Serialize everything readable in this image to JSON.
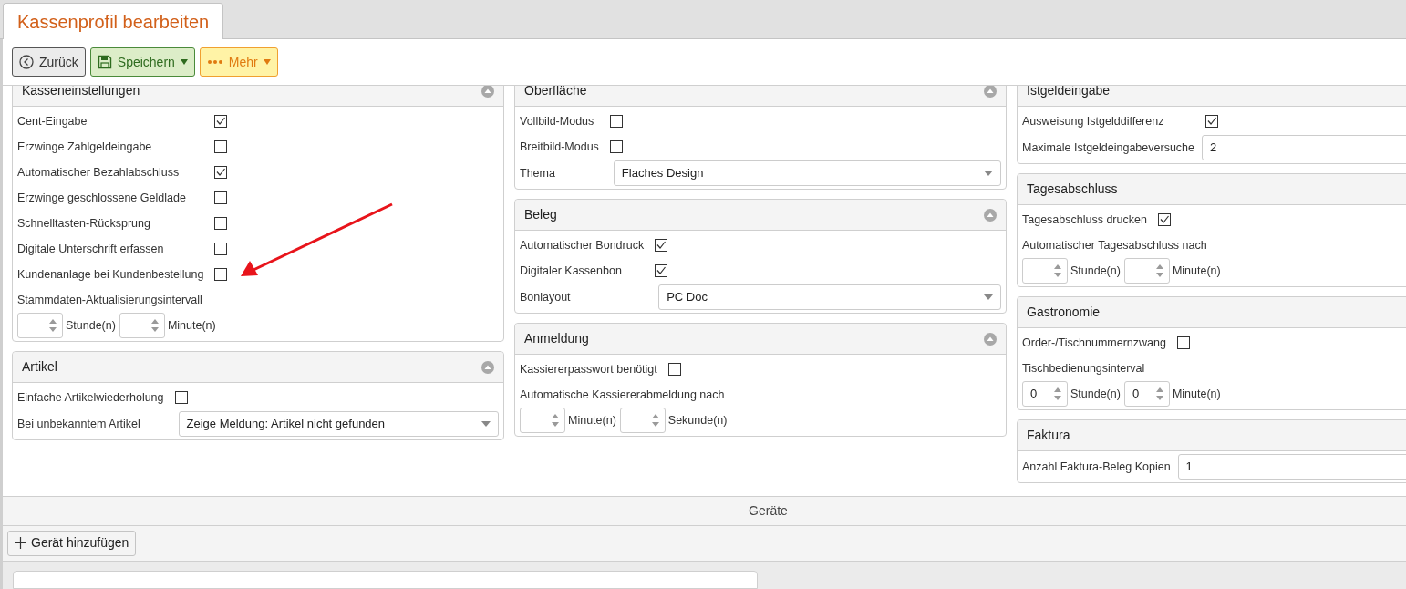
{
  "tab": {
    "label": "Kassenprofil bearbeiten",
    "selected": true
  },
  "toolbar": [
    {
      "kind": "back",
      "label": "Zurück"
    },
    {
      "kind": "save",
      "label": "Speichern"
    },
    {
      "kind": "more",
      "label": "Mehr"
    }
  ],
  "columns": [
    [
      {
        "title": "Kasseneinstellungen",
        "expanded": true,
        "rows": [
          {
            "kind": "checkbox",
            "label": "Cent-Eingabe",
            "checked": true
          },
          {
            "kind": "checkbox",
            "label": "Erzwinge Zahlgeldeingabe",
            "checked": false
          },
          {
            "kind": "checkbox",
            "label": "Automatischer Bezahlabschluss",
            "checked": true
          },
          {
            "kind": "checkbox",
            "label": "Erzwinge geschlossene Geldlade",
            "checked": false
          },
          {
            "kind": "checkbox",
            "label": "Schnelltasten-Rücksprung",
            "checked": false
          },
          {
            "kind": "checkbox",
            "label": "Digitale Unterschrift erfassen",
            "checked": false
          },
          {
            "kind": "checkbox",
            "label": "Kundenanlage bei Kundenbestellung",
            "checked": false
          },
          {
            "kind": "interval",
            "label": "Stammdaten-Aktualisierungsintervall",
            "units": [
              {
                "unit": "Stunde(n)"
              },
              {
                "unit": "Minute(n)"
              }
            ]
          }
        ]
      },
      {
        "title": "Artikel",
        "expanded": true,
        "rows": [
          {
            "kind": "checkbox",
            "label": "Einfache Artikelwiederholung",
            "checked": false
          },
          {
            "kind": "select",
            "label": "Bei unbekanntem Artikel",
            "value": "Zeige Meldung: Artikel nicht gefunden"
          }
        ]
      }
    ],
    [
      {
        "title": "Oberfläche",
        "expanded": true,
        "rows": [
          {
            "kind": "checkbox",
            "label": "Vollbild-Modus",
            "checked": false
          },
          {
            "kind": "checkbox",
            "label": "Breitbild-Modus",
            "checked": false
          },
          {
            "kind": "select",
            "label": "Thema",
            "value": "Flaches Design"
          }
        ]
      },
      {
        "title": "Beleg",
        "expanded": true,
        "rows": [
          {
            "kind": "checkbox",
            "label": "Automatischer Bondruck",
            "checked": true
          },
          {
            "kind": "checkbox",
            "label": "Digitaler Kassenbon",
            "checked": true
          },
          {
            "kind": "select",
            "label": "Bonlayout",
            "value": "PC Doc"
          }
        ]
      },
      {
        "title": "Anmeldung",
        "expanded": true,
        "rows": [
          {
            "kind": "checkbox",
            "label": "Kassiererpasswort benötigt",
            "checked": false
          },
          {
            "kind": "interval",
            "label": "Automatische Kassiererabmeldung nach",
            "units": [
              {
                "unit": "Minute(n)"
              },
              {
                "unit": "Sekunde(n)"
              }
            ]
          }
        ]
      }
    ],
    [
      {
        "title": "Istgeldeingabe",
        "rows": [
          {
            "kind": "checkbox",
            "label": "Ausweisung Istgelddifferenz",
            "checked": true
          },
          {
            "kind": "input",
            "label": "Maximale Istgeldeingabeversuche",
            "value": "2"
          }
        ]
      },
      {
        "title": "Tagesabschluss",
        "rows": [
          {
            "kind": "checkbox",
            "label": "Tagesabschluss drucken",
            "checked": true
          },
          {
            "kind": "interval",
            "label": "Automatischer Tagesabschluss nach",
            "units": [
              {
                "unit": "Stunde(n)"
              },
              {
                "unit": "Minute(n)"
              }
            ]
          }
        ]
      },
      {
        "title": "Gastronomie",
        "rows": [
          {
            "kind": "checkbox",
            "label": "Order-/Tischnummernzwang",
            "checked": false
          },
          {
            "kind": "interval",
            "label": "Tischbedienungsinterval",
            "units": [
              {
                "value": "0",
                "unit": "Stunde(n)"
              },
              {
                "value": "0",
                "unit": "Minute(n)"
              }
            ]
          }
        ]
      },
      {
        "title": "Faktura",
        "rows": [
          {
            "kind": "input",
            "label": "Anzahl Faktura-Beleg Kopien",
            "value": "1"
          }
        ]
      }
    ]
  ],
  "devices": {
    "title": "Geräte",
    "add_button": "Gerät hinzufügen"
  }
}
